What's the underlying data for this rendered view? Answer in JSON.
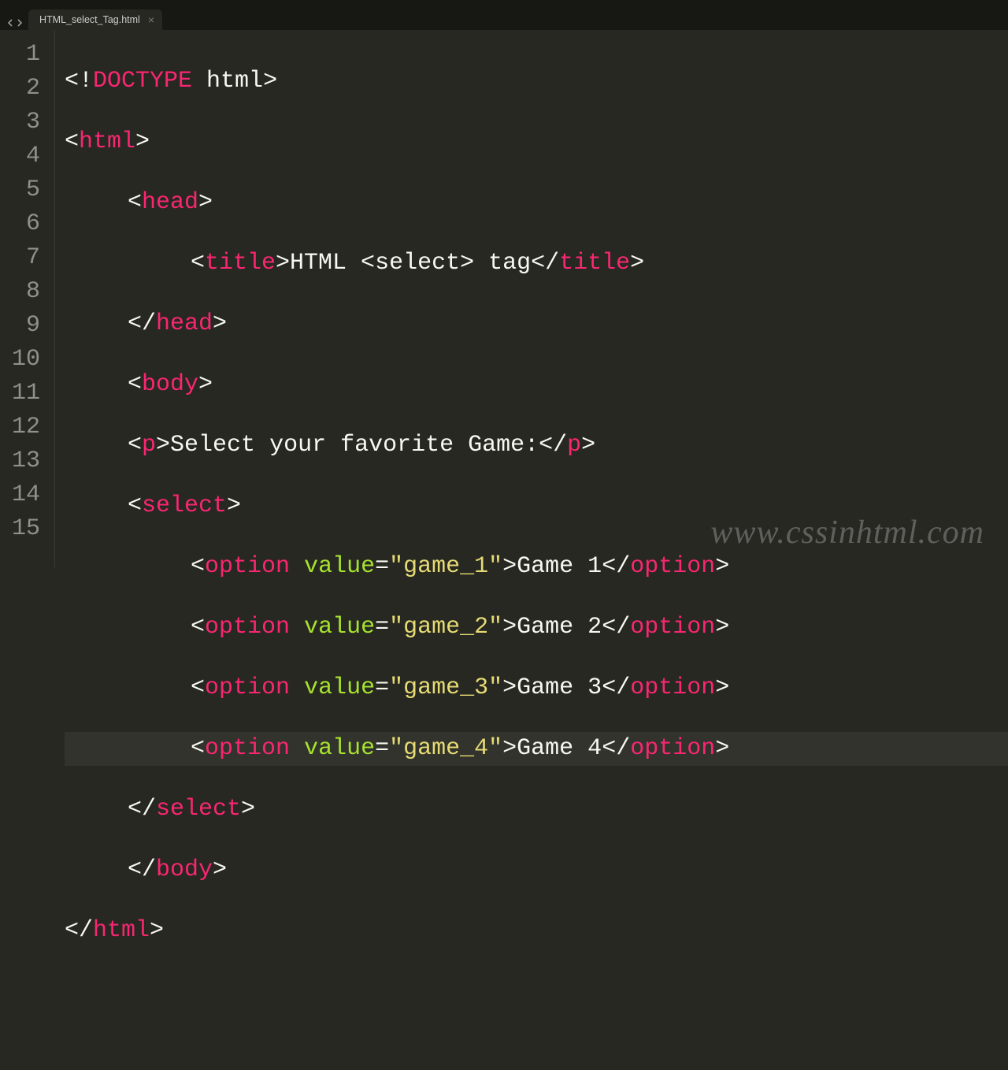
{
  "tab": {
    "filename": "HTML_select_Tag.html"
  },
  "watermark": "www.cssinhtml.com",
  "line_numbers": [
    "1",
    "2",
    "3",
    "4",
    "5",
    "6",
    "7",
    "8",
    "9",
    "10",
    "11",
    "12",
    "13",
    "14",
    "15"
  ],
  "code": {
    "l1": {
      "open": "<!",
      "kw": "DOCTYPE",
      "rest": " html",
      "close": ">"
    },
    "l2": {
      "lt": "<",
      "tag": "html",
      "gt": ">"
    },
    "l3": {
      "lt": "<",
      "tag": "head",
      "gt": ">"
    },
    "l4": {
      "lt": "<",
      "otag": "title",
      "gt": ">",
      "text": "HTML <select> tag",
      "lt2": "</",
      "ctag": "title",
      "gt2": ">"
    },
    "l5": {
      "lt": "</",
      "tag": "head",
      "gt": ">"
    },
    "l6": {
      "lt": "<",
      "tag": "body",
      "gt": ">"
    },
    "l7": {
      "lt": "<",
      "otag": "p",
      "gt": ">",
      "text": "Select your favorite Game:",
      "lt2": "</",
      "ctag": "p",
      "gt2": ">"
    },
    "l8": {
      "lt": "<",
      "tag": "select",
      "gt": ">"
    },
    "l9": {
      "lt": "<",
      "otag": "option",
      "sp": " ",
      "attr": "value",
      "eq": "=",
      "q1": "\"",
      "val": "game_1",
      "q2": "\"",
      "gt": ">",
      "text": "Game 1",
      "lt2": "</",
      "ctag": "option",
      "gt2": ">"
    },
    "l10": {
      "lt": "<",
      "otag": "option",
      "sp": " ",
      "attr": "value",
      "eq": "=",
      "q1": "\"",
      "val": "game_2",
      "q2": "\"",
      "gt": ">",
      "text": "Game 2",
      "lt2": "</",
      "ctag": "option",
      "gt2": ">"
    },
    "l11": {
      "lt": "<",
      "otag": "option",
      "sp": " ",
      "attr": "value",
      "eq": "=",
      "q1": "\"",
      "val": "game_3",
      "q2": "\"",
      "gt": ">",
      "text": "Game 3",
      "lt2": "</",
      "ctag": "option",
      "gt2": ">"
    },
    "l12": {
      "lt": "<",
      "otag": "option",
      "sp": " ",
      "attr": "value",
      "eq": "=",
      "q1": "\"",
      "val": "game_4",
      "q2": "\"",
      "gt": ">",
      "text": "Game 4",
      "lt2": "</",
      "ctag": "option",
      "gt2": ">"
    },
    "l13": {
      "lt": "</",
      "tag": "select",
      "gt": ">"
    },
    "l14": {
      "lt": "</",
      "tag": "body",
      "gt": ">"
    },
    "l15": {
      "lt": "</",
      "tag": "html",
      "gt": ">"
    }
  }
}
